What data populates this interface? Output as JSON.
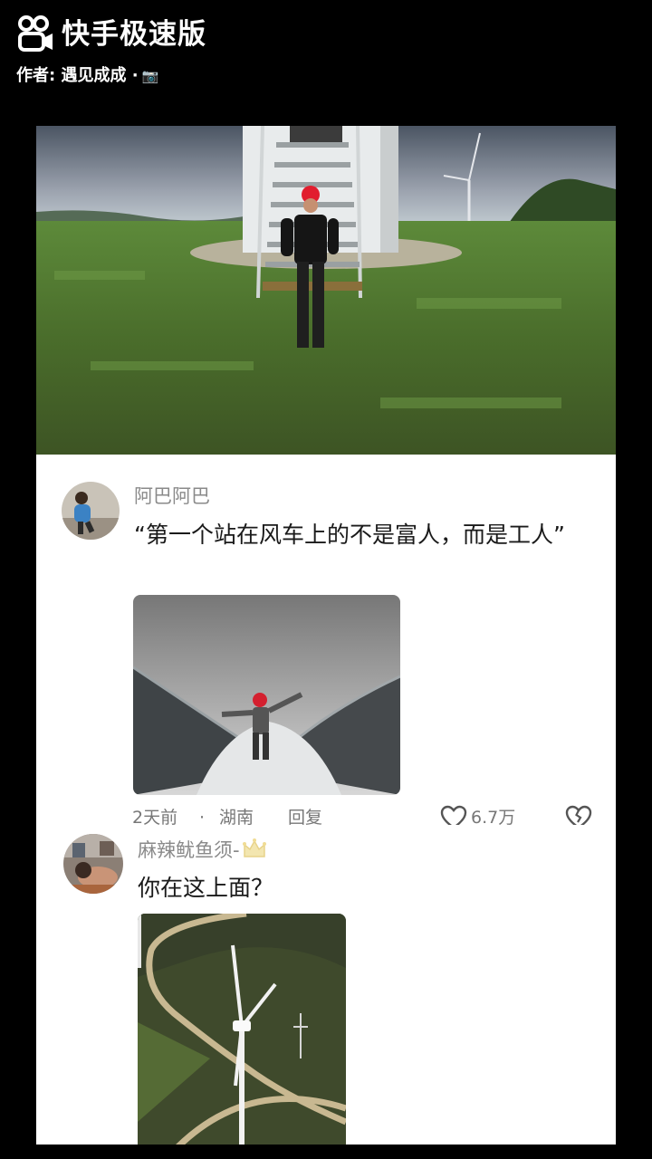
{
  "watermark": {
    "app_name": "快手极速版",
    "author": "作者: 遇见成成 ·",
    "camera_icon": "camera-emoji-icon",
    "logo_icon": "kuaishou-logo-icon"
  },
  "comments": [
    {
      "username": "阿巴阿巴",
      "text": "“第一个站在风车上的不是富人，而是工人”",
      "time": "2天前",
      "dot": "·",
      "location": "湖南",
      "reply_label": "回复",
      "like_count": "6.7万",
      "like_icon": "heart-icon",
      "dislike_icon": "broken-heart-icon"
    },
    {
      "username": "麻辣鱿鱼须-",
      "badge_icon": "crown-icon",
      "text": "你在这上面？"
    }
  ],
  "colors": {
    "background": "#000000",
    "panel": "#ffffff",
    "username": "#8a8a8a",
    "text": "#1a1a1a"
  }
}
